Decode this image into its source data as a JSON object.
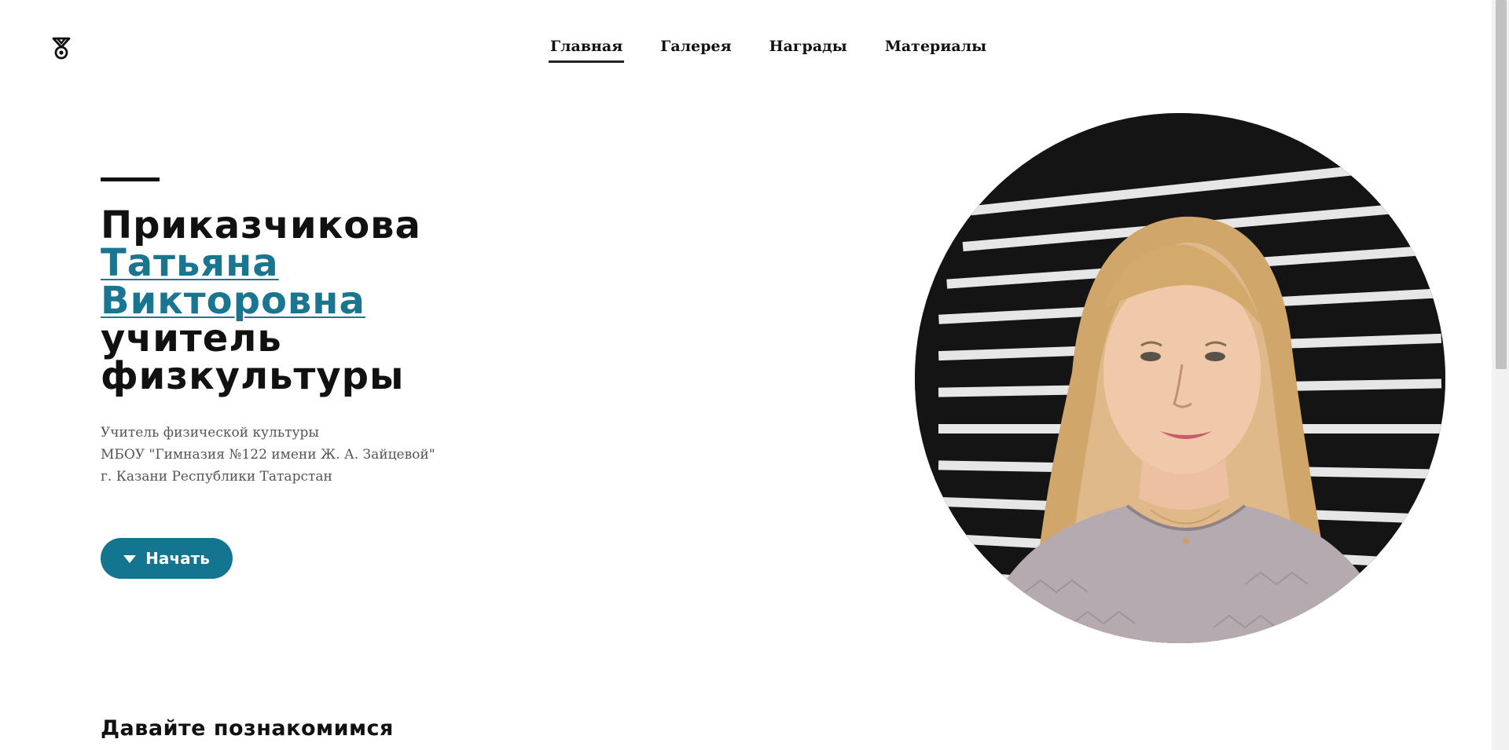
{
  "nav": {
    "items": [
      {
        "label": "Главная",
        "active": true
      },
      {
        "label": "Галерея",
        "active": false
      },
      {
        "label": "Награды",
        "active": false
      },
      {
        "label": "Материалы",
        "active": false
      }
    ]
  },
  "hero": {
    "surname": "Приказчикова",
    "first_name": "Татьяна",
    "patronymic": "Викторовна",
    "role_line1": "учитель",
    "role_line2": "физкультуры",
    "description": [
      "Учитель физической культуры",
      "МБОУ \"Гимназия №122 имени Ж. А. Зайцевой\"",
      "г. Казани Республики Татарстан"
    ],
    "start_label": "Начать"
  },
  "about": {
    "title": "Давайте познакомимся"
  },
  "colors": {
    "accent": "#13758f",
    "text": "#111111",
    "muted": "#555555"
  },
  "icons": {
    "logo": "medal-icon",
    "start": "triangle-down-icon"
  }
}
